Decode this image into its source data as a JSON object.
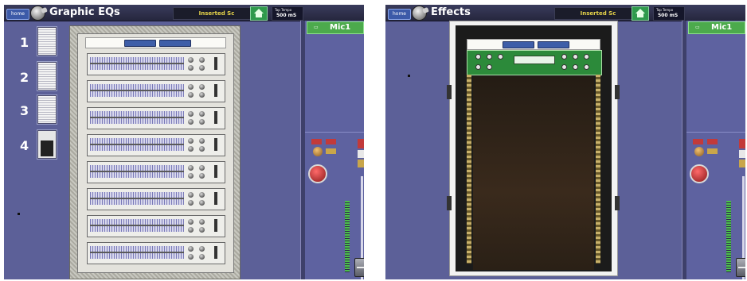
{
  "screens": [
    {
      "id": "graphic-eqs",
      "title": "Graphic EQs",
      "home_label": "home",
      "inserted_label": "Inserted Sc",
      "tap_label": "Tap Tempo",
      "tap_value": "500 mS",
      "channel_name": "Mic1",
      "presets": [
        "1",
        "2",
        "3",
        "4"
      ]
    },
    {
      "id": "effects",
      "title": "Effects",
      "home_label": "home",
      "inserted_label": "Inserted Sc",
      "tap_label": "Tap Tempo",
      "tap_value": "500 mS",
      "channel_name": "Mic1"
    }
  ],
  "colors": {
    "background": "#5c6098",
    "accent_green": "#4caa4c",
    "inserted_text": "#e6d34a"
  }
}
